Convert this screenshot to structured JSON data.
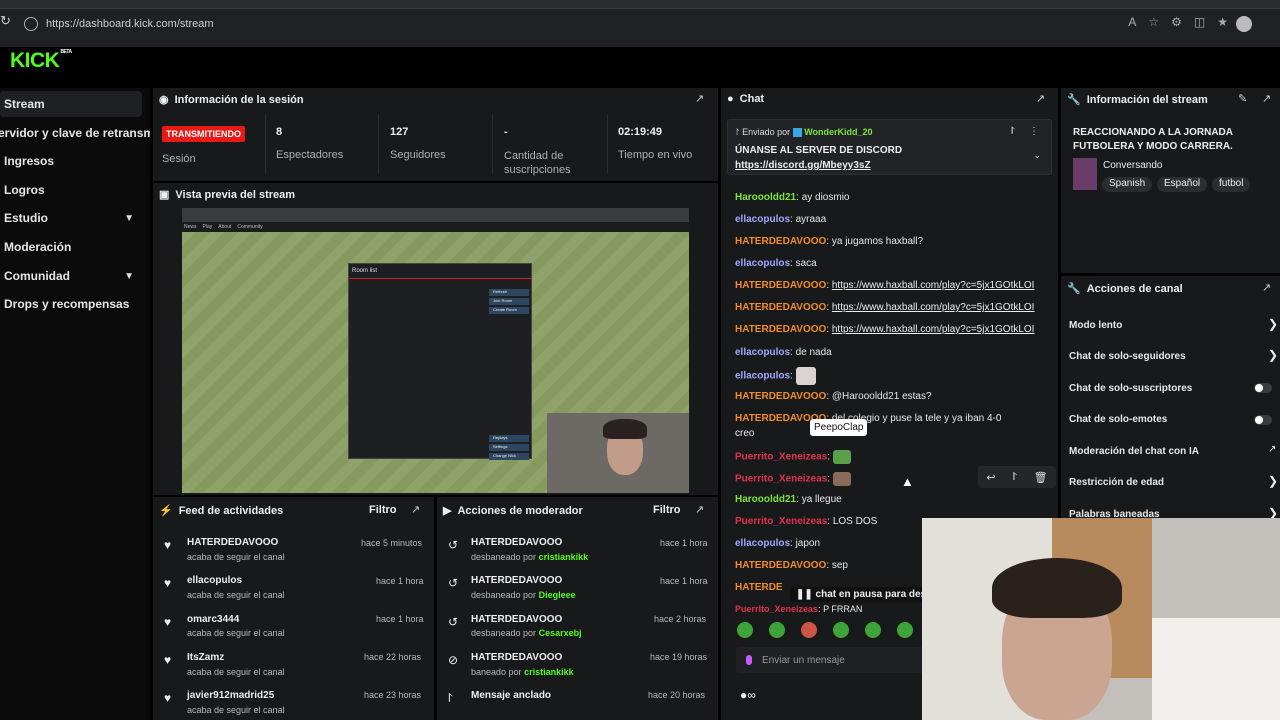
{
  "browser": {
    "url": "https://dashboard.kick.com/stream"
  },
  "brand": {
    "logo": "KICK",
    "beta": "BETA",
    "accent": "#53fc18"
  },
  "sidebar": {
    "items": [
      {
        "label": "Stream"
      },
      {
        "label": "Servidor y clave de retransmisión"
      },
      {
        "label": "Ingresos"
      },
      {
        "label": "Logros"
      },
      {
        "label": "Estudio"
      },
      {
        "label": "Moderación"
      },
      {
        "label": "Comunidad"
      },
      {
        "label": "Drops y recompensas"
      }
    ]
  },
  "session": {
    "title": "Información de la sesión",
    "badge": "TRANSMITIENDO",
    "stats": [
      {
        "label": "Sesión",
        "value": ""
      },
      {
        "label": "Espectadores",
        "value": "8"
      },
      {
        "label": "Seguidores",
        "value": "127"
      },
      {
        "label": "Cantidad de suscripciones",
        "value": "-"
      },
      {
        "label": "Tiempo en vivo",
        "value": "02:19:49"
      }
    ]
  },
  "preview": {
    "title": "Vista previa del stream",
    "nav": [
      "News",
      "Play",
      "About",
      "Community"
    ],
    "room_list": "Room list",
    "room_buttons": [
      "Refresh",
      "Join Room",
      "Create Room"
    ],
    "room_bottom": [
      "Replays",
      "Settings",
      "Change Nick"
    ]
  },
  "feed": {
    "title": "Feed de actividades",
    "filter": "Filtro",
    "items": [
      {
        "name": "HATERDEDAVOOO",
        "sub": "acaba de seguir el canal",
        "time": "hace 5 minutos"
      },
      {
        "name": "ellacopulos",
        "sub": "acaba de seguir el canal",
        "time": "hace 1 hora"
      },
      {
        "name": "omarc3444",
        "sub": "acaba de seguir el canal",
        "time": "hace 1 hora"
      },
      {
        "name": "ItsZamz",
        "sub": "acaba de seguir el canal",
        "time": "hace 22 horas"
      },
      {
        "name": "javier912madrid25",
        "sub": "acaba de seguir el canal",
        "time": "hace 23 horas"
      }
    ]
  },
  "mod": {
    "title": "Acciones de moderador",
    "filter": "Filtro",
    "items": [
      {
        "name": "HATERDEDAVOOO",
        "action": "desbaneado por",
        "by": "cristiankikk",
        "time": "hace 1 hora"
      },
      {
        "name": "HATERDEDAVOOO",
        "action": "desbaneado por",
        "by": "Diegleee",
        "time": "hace 1 hora"
      },
      {
        "name": "HATERDEDAVOOO",
        "action": "desbaneado por",
        "by": "Cesarxebj",
        "time": "hace 2 horas"
      },
      {
        "name": "HATERDEDAVOOO",
        "action": "baneado por",
        "by": "cristiankikk",
        "time": "hace 19 horas"
      },
      {
        "name": "Mensaje anclado",
        "action": "",
        "by": "",
        "time": "hace 20 horas"
      }
    ]
  },
  "chat": {
    "title": "Chat",
    "pinned": {
      "sent_by": "Enviado por",
      "user": "WonderKidd_20",
      "text": "ÚNANSE AL SERVER DE DISCORD",
      "link": "https://discord.gg/Mbeyy3sZ"
    },
    "messages": [
      {
        "user": "Haroooldd21",
        "text": "ay diosmio"
      },
      {
        "user": "ellacopulos",
        "text": "ayraaa"
      },
      {
        "user": "HATERDEDAVOOO",
        "text": "ya jugamos haxball?"
      },
      {
        "user": "ellacopulos",
        "text": "saca"
      },
      {
        "user": "HATERDEDAVOOO",
        "text": "https://www.haxball.com/play?c=5jx1GOtkLOI"
      },
      {
        "user": "HATERDEDAVOOO",
        "text": "https://www.haxball.com/play?c=5jx1GOtkLOI"
      },
      {
        "user": "HATERDEDAVOOO",
        "text": "https://www.haxball.com/play?c=5jx1GOtkLOI"
      },
      {
        "user": "ellacopulos",
        "text": "de nada"
      },
      {
        "user": "ellacopulos",
        "text": ""
      },
      {
        "user": "HATERDEDAVOOO",
        "text": "@Haroooldd21 estas?"
      },
      {
        "user": "HATERDEDAVOOO",
        "text": "del colegio y puse la tele y ya iban 4-0"
      },
      {
        "user": "",
        "text": "creo"
      },
      {
        "user": "Puerrito_Xeneizeas",
        "text": ""
      },
      {
        "user": "Puerrito_Xeneizeas",
        "text": ""
      },
      {
        "user": "Haroooldd21",
        "text": "ya llegue"
      },
      {
        "user": "Puerrito_Xeneizeas",
        "text": "LOS DOS"
      },
      {
        "user": "ellacopulos",
        "text": "japon"
      },
      {
        "user": "HATERDEDAVOOO",
        "text": "sep"
      },
      {
        "user": "HATERDE",
        "text": ""
      },
      {
        "user": "Puerrito_Xeneizeas",
        "text": "P FRRAN"
      }
    ],
    "tooltip": "PeepoClap",
    "pause": "chat en pausa para des",
    "input_placeholder": "Enviar un mensaje"
  },
  "stream_info": {
    "title": "Información del stream",
    "stream_title": "REACCIONANDO A LA JORNADA FUTBOLERA Y MODO CARRERA.",
    "category": "Conversando",
    "tags": [
      "Spanish",
      "Español",
      "futbol"
    ]
  },
  "channel_actions": {
    "title": "Acciones de canal",
    "items": [
      {
        "label": "Modo lento",
        "control": "chevron"
      },
      {
        "label": "Chat de solo-seguidores",
        "control": "chevron"
      },
      {
        "label": "Chat de solo-suscriptores",
        "control": "toggle"
      },
      {
        "label": "Chat de solo-emotes",
        "control": "toggle"
      },
      {
        "label": "Moderación del chat con IA",
        "control": "external"
      },
      {
        "label": "Restricción de edad",
        "control": "chevron"
      },
      {
        "label": "Palabras baneadas",
        "control": "chevron"
      }
    ]
  }
}
